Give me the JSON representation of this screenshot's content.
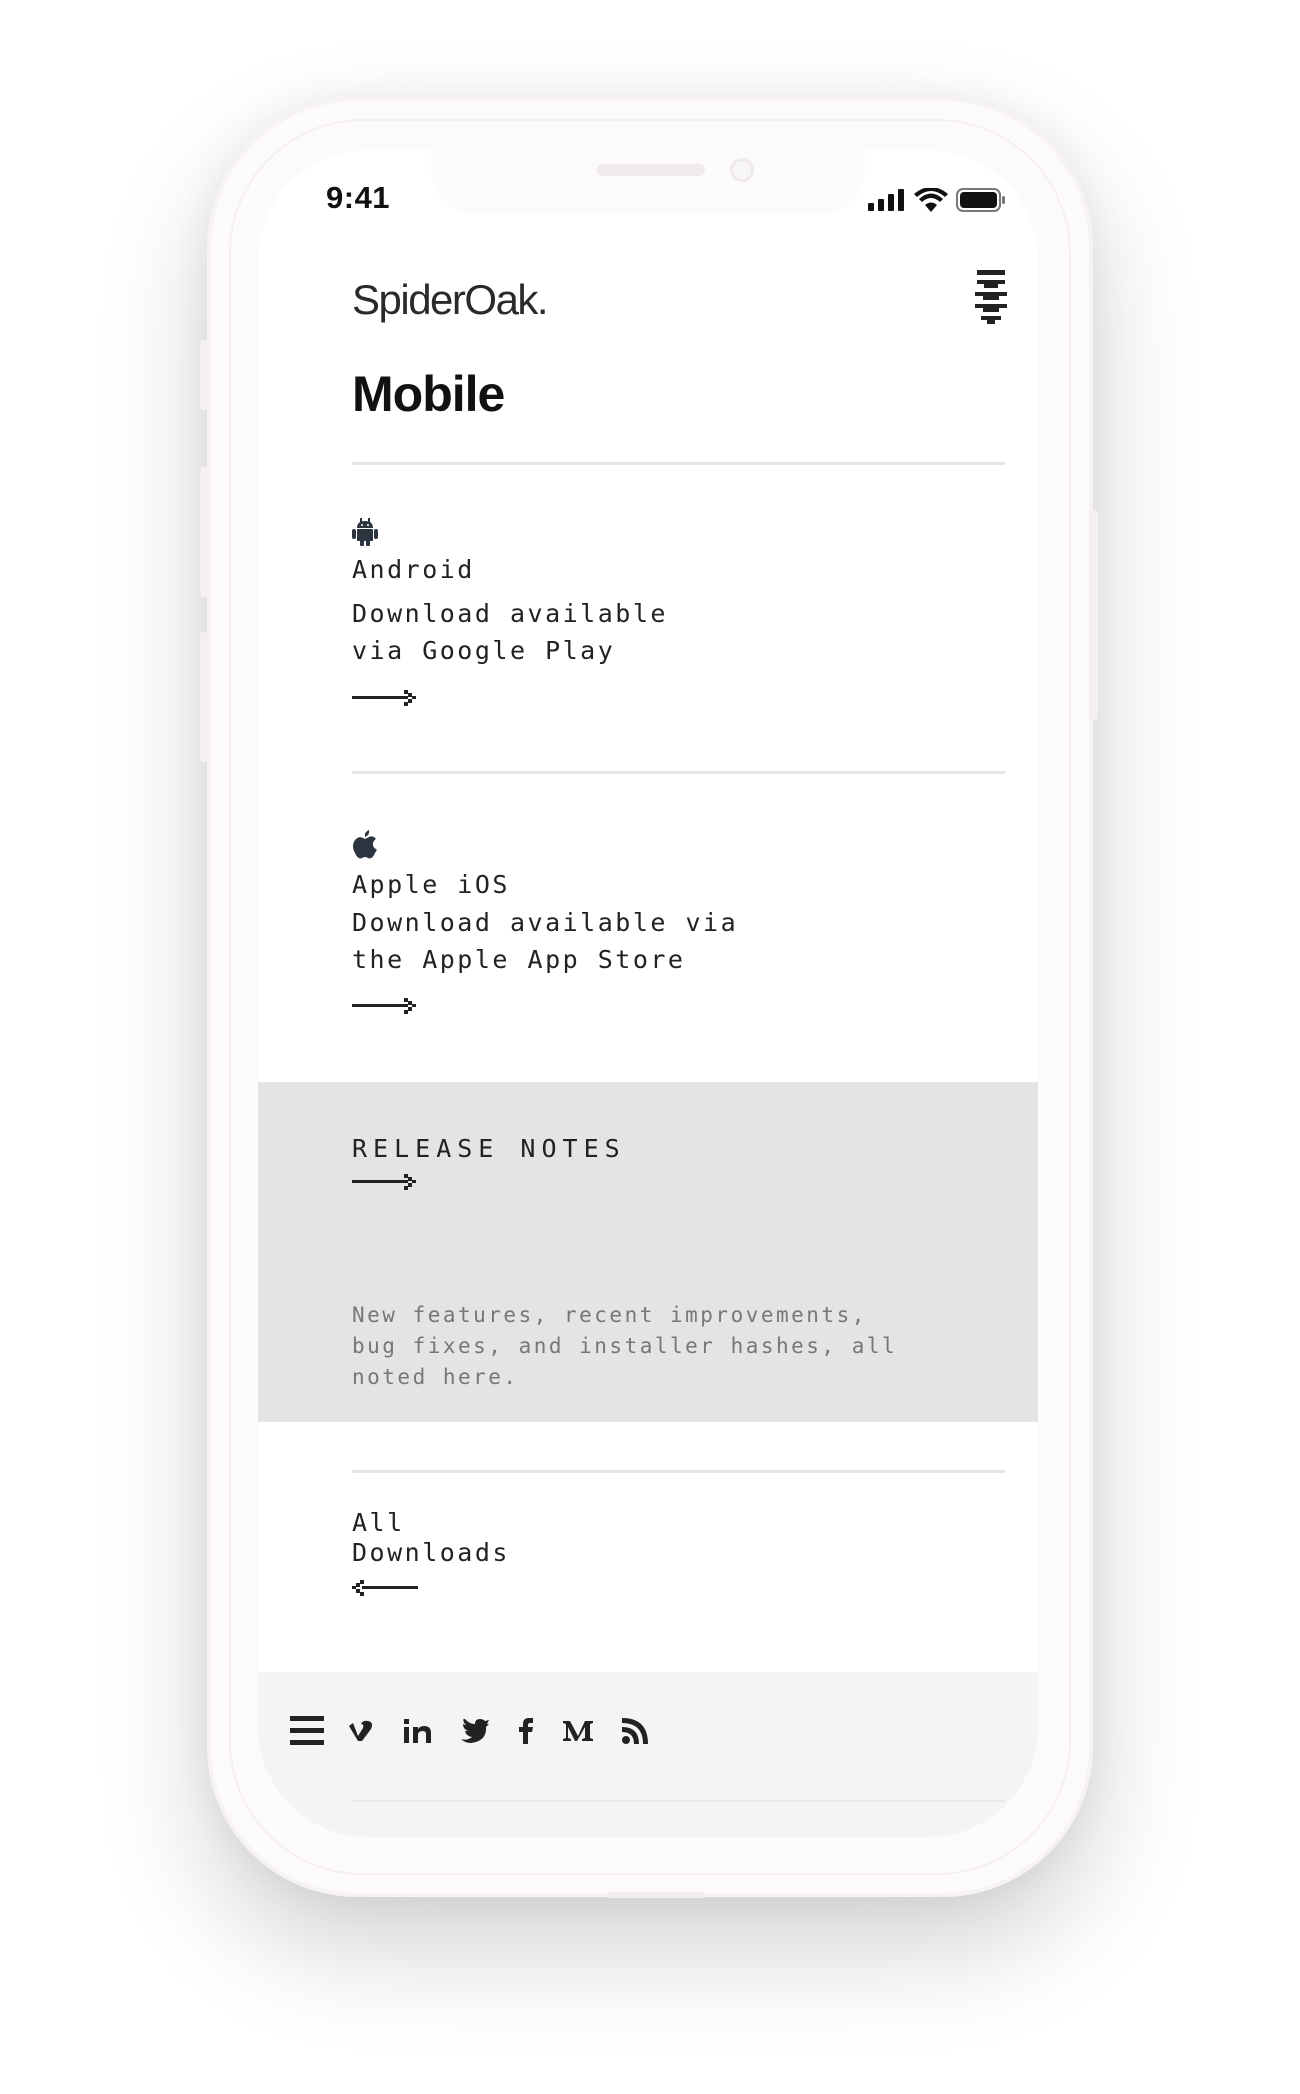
{
  "status_bar": {
    "time": "9:41",
    "icons": [
      "signal-icon",
      "wifi-icon",
      "battery-icon"
    ]
  },
  "header": {
    "logo": "SpiderOak.",
    "menu_icon": "stack-menu-icon"
  },
  "page": {
    "title": "Mobile"
  },
  "downloads": [
    {
      "icon": "android-icon",
      "name": "Android",
      "description": "Download available\nvia Google Play",
      "arrow": "arrow-right-icon"
    },
    {
      "icon": "apple-icon",
      "name": "Apple iOS",
      "description": "Download available via\nthe Apple App Store",
      "arrow": "arrow-right-icon"
    }
  ],
  "release_notes": {
    "title": "RELEASE NOTES",
    "description": "New features, recent improvements,\nbug fixes, and installer hashes, all\nnoted here."
  },
  "all_downloads": {
    "label": "All\nDownloads",
    "arrow": "arrow-left-icon"
  },
  "footer": {
    "icons": [
      "hamburger-menu-icon",
      "vimeo-icon",
      "linkedin-icon",
      "twitter-icon",
      "facebook-icon",
      "medium-icon",
      "rss-icon"
    ]
  },
  "colors": {
    "release_background": "#e4e4e4",
    "footer_background": "#f4f4f4",
    "text": "#222222",
    "muted_text": "#777777"
  }
}
